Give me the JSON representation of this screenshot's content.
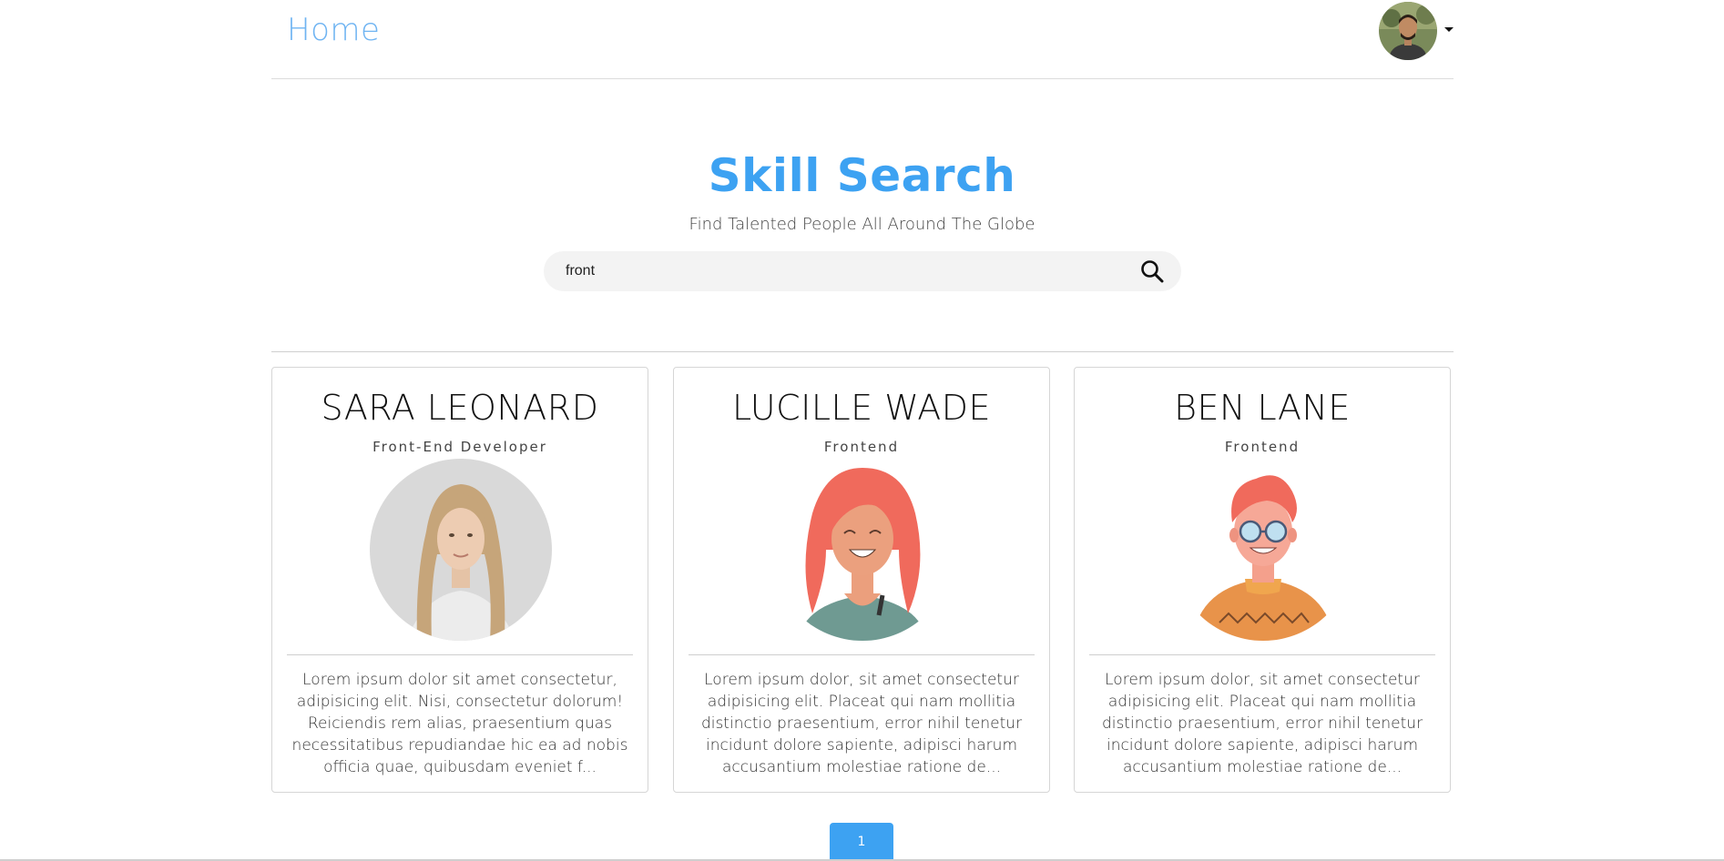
{
  "nav": {
    "home_label": "Home"
  },
  "hero": {
    "title": "Skill Search",
    "subtitle": "Find Talented People All Around The Globe"
  },
  "search": {
    "value": "front",
    "placeholder": ""
  },
  "profiles": [
    {
      "name": "SARA LEONARD",
      "role": "Front-End Developer",
      "description": "Lorem ipsum dolor sit amet consectetur, adipisicing elit. Nisi, consectetur dolorum! Reiciendis rem alias, praesentium quas necessitatibus repudiandae hic ea ad nobis officia quae, quibusdam eveniet f..."
    },
    {
      "name": "LUCILLE WADE",
      "role": "Frontend",
      "description": "Lorem ipsum dolor, sit amet consectetur adipisicing elit. Placeat qui nam mollitia distinctio praesentium, error nihil tenetur incidunt dolore sapiente, adipisci harum accusantium molestiae ratione de..."
    },
    {
      "name": "BEN LANE",
      "role": "Frontend",
      "description": "Lorem ipsum dolor, sit amet consectetur adipisicing elit. Placeat qui nam mollitia distinctio praesentium, error nihil tenetur incidunt dolore sapiente, adipisci harum accusantium molestiae ratione de..."
    }
  ],
  "pagination": {
    "current": "1"
  },
  "colors": {
    "accent": "#3da2f2",
    "home_link": "#6fb4f2"
  }
}
